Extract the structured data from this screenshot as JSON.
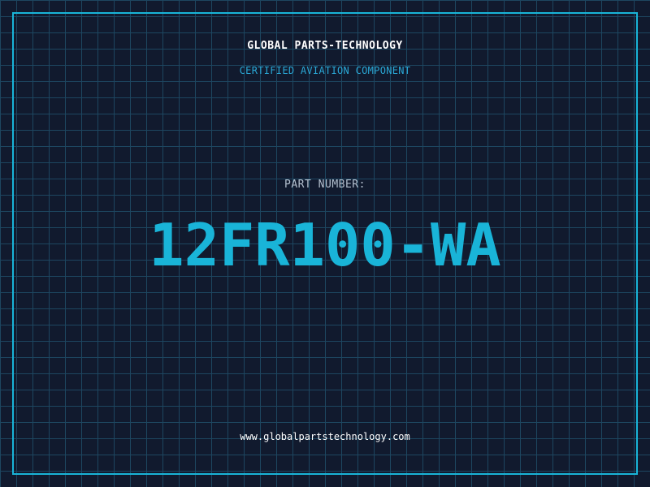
{
  "brand": "GLOBAL PARTS-TECHNOLOGY",
  "subtitle": "CERTIFIED AVIATION COMPONENT",
  "part_label": "PART NUMBER:",
  "part_number": "12FR100-WA",
  "website": "www.globalpartstechnology.com",
  "colors": {
    "background": "#111a2e",
    "grid": "#1d4660",
    "accent": "#19b4d8",
    "label": "#b4c0cf",
    "text": "#ffffff"
  }
}
